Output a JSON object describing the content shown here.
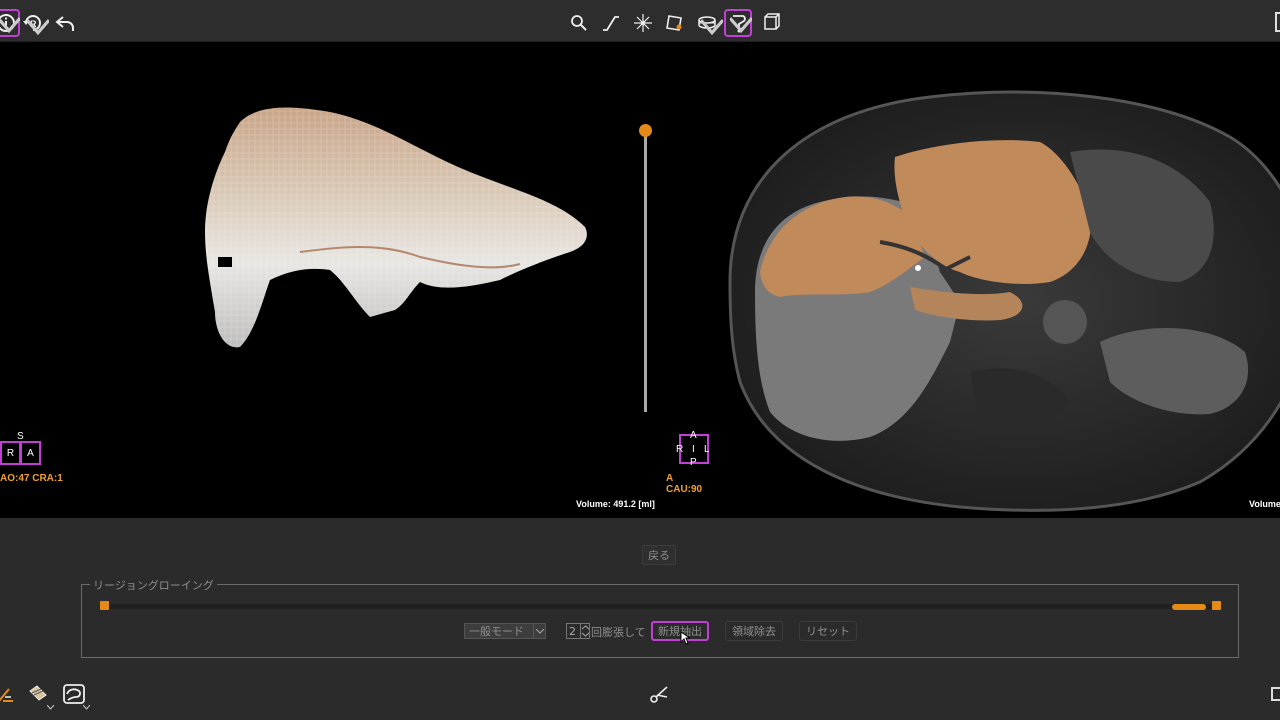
{
  "toolbar": {
    "left_icons": [
      "info-icon",
      "rotate-r-icon",
      "undo-icon"
    ],
    "center_icons": [
      "zoom-icon",
      "window-level-icon",
      "pan-icon",
      "edit-roi-icon",
      "layers-icon",
      "lasso-icon",
      "cube-icon"
    ],
    "active_tool": "lasso-icon"
  },
  "viewport_left": {
    "orientation": {
      "top": "S",
      "left": "R",
      "right": "A"
    },
    "angle_label": "AO:47 CRA:1",
    "volume_label": "Volume: 491.2 [ml]"
  },
  "viewport_right": {
    "orientation": {
      "top": "A",
      "left": "R",
      "center": "I",
      "right": "L",
      "bottom": "P"
    },
    "angle_label": "A CAU:90",
    "volume_label": "Volume"
  },
  "panel": {
    "back_button": "戻る",
    "group_title": "リージョングローイング",
    "mode_select": "一般モード",
    "dilate_count": "2",
    "dilate_label": "回膨張して",
    "extract_button": "新規抽出",
    "remove_button": "領域除去",
    "reset_button": "リセット"
  },
  "colors": {
    "accent": "#c23fd6",
    "orange": "#e58a16",
    "label_orange": "#f0a030"
  }
}
